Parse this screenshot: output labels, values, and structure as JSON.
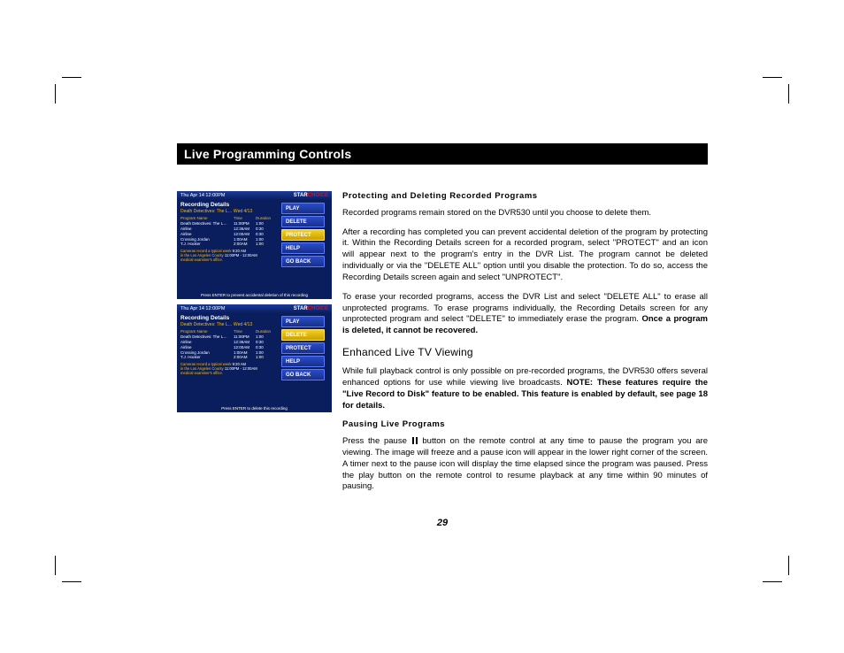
{
  "header": {
    "title": "Live Programming Controls"
  },
  "page_number": "29",
  "sections": {
    "protecting_head": "Protecting and Deleting Recorded Programs",
    "protecting_p1": "Recorded programs remain stored on the DVR530 until you choose to delete them.",
    "protecting_p2": "After a recording has completed you can prevent accidental deletion of the program by protecting it.  Within the Recording Details screen for a recorded program, select \"PROTECT\" and an icon will appear next to the program's entry in the DVR List. The program cannot be deleted individually or via the \"DELETE ALL\" option until you disable the protection. To do so, access the Recording Details screen again and select \"UNPROTECT\".",
    "protecting_p3a": "To erase your recorded programs, access the DVR List and select \"DELETE ALL\" to erase all unprotected programs. To erase programs individually, the Recording Details screen for any unprotected program and select \"DELETE\" to immediately erase the program. ",
    "protecting_p3b": "Once a program is deleted, it cannot be recovered.",
    "enhanced_head": "Enhanced Live TV Viewing",
    "enhanced_p1a": "While full playback control is only possible on pre-recorded programs, the DVR530 offers several enhanced options for use while viewing live broadcasts. ",
    "enhanced_p1b": "NOTE: These features require the \"Live Record to Disk\" feature to be enabled. This feature is enabled by default, see page 18 for details.",
    "pausing_head": "Pausing Live Programs",
    "pausing_p1a": "Press the pause ",
    "pausing_p1b": " button on the remote control at any time to pause the program you are viewing. The image will freeze and a pause icon will appear in the lower right corner of the screen. A timer next to the pause icon will display the time elapsed since the program was paused. Press the play button on the remote control to resume playback at any time within 90 minutes of pausing."
  },
  "dvr": {
    "timestamp": "Thu Apr 14 12:00PM",
    "logo1": "STAR",
    "logo2": "CHOICE",
    "title": "Recording Details",
    "subtitle": "Death Detectives: The L…   Wed 4/13",
    "col_prog": "Program Name",
    "col_time": "Time",
    "col_dur": "Duration",
    "rows": [
      {
        "n": "Death Detectives: The L…",
        "t": "11:00PM",
        "d": "1:00"
      },
      {
        "n": "Airline",
        "t": "12:36AM",
        "d": "0:30"
      },
      {
        "n": "Airline",
        "t": "12:00AM",
        "d": "0:30"
      },
      {
        "n": "Crossing Jordan",
        "t": "1:00AM",
        "d": "1:00"
      },
      {
        "n": "T.J. Hooker",
        "t": "2:00AM",
        "d": "1:00"
      }
    ],
    "desc1": "Cameras record a typical week",
    "desc_time": "9:20 AM",
    "desc2": "in the Los Angeles County",
    "desc2b": "11:00PM - 12:00AM",
    "desc3": "medical examiner's office.",
    "buttons": [
      "PLAY",
      "DELETE",
      "PROTECT",
      "HELP",
      "GO BACK"
    ],
    "foot1": "Press ENTER to prevent accidental deletion of this recording",
    "foot2": "Press ENTER to delete this recording"
  }
}
